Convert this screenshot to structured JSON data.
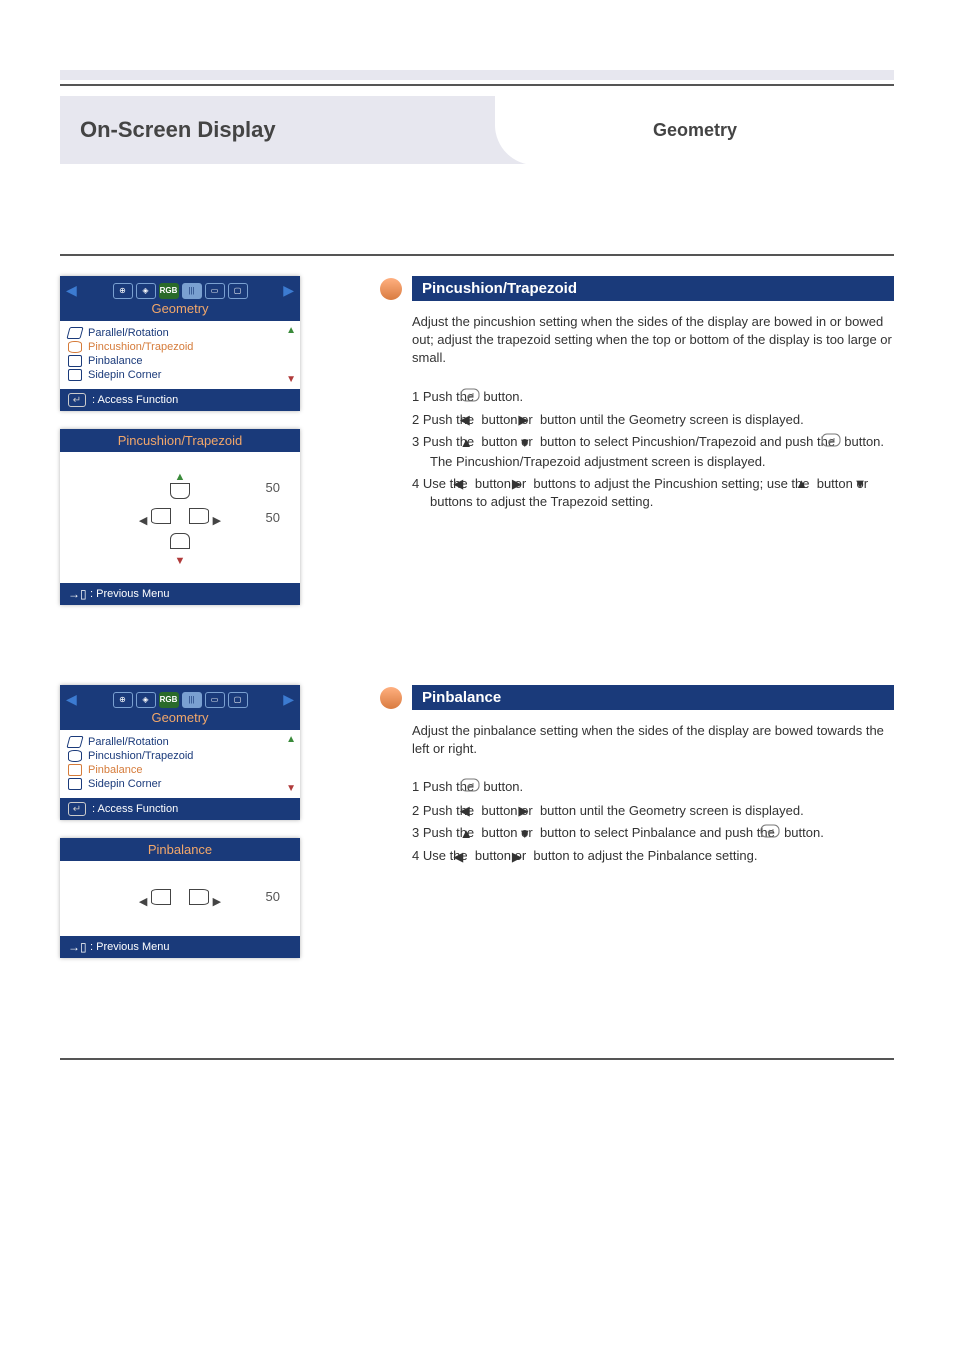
{
  "page_title": "On-Screen Display",
  "page_subtitle": "Geometry",
  "osd_common": {
    "menu_title": "Geometry",
    "items": [
      {
        "label": "Parallel/Rotation"
      },
      {
        "label": "Pincushion/Trapezoid"
      },
      {
        "label": "Pinbalance"
      },
      {
        "label": "Sidepin Corner"
      }
    ],
    "access_label": ": Access Function",
    "previous_label": ": Previous Menu",
    "header_icons": [
      "position",
      "focus",
      "RGB",
      "bars",
      "page",
      "screen"
    ]
  },
  "section_pin": {
    "heading": "Pincushion/Trapezoid",
    "description": "Adjust the pincushion setting when the sides of the display are bowed in or bowed out; adjust the trapezoid setting when the top or bottom of the display is too large or small.",
    "steps": {
      "s1": "1   Push the ",
      "s1b": " button.",
      "s2": "2   Push the ",
      "s2mid": " button or ",
      "s2end": " button until the Geometry screen is displayed.",
      "s3": "3   Push the ",
      "s3mid": " button or ",
      "s3end": " button to select Pincushion/Trapezoid and push the ",
      "s3end2": " button. The Pincushion/Trapezoid adjustment screen is displayed.",
      "s4": "4   Use the ",
      "s4mid": " button or ",
      "s4end": " buttons to adjust the Pincushion setting; use the ",
      "s4b": " button or ",
      "s4c": " buttons to adjust the Trapezoid setting."
    },
    "adjust_title": "Pincushion/Trapezoid",
    "value1": "50",
    "value2": "50"
  },
  "section_pinbal": {
    "heading": "Pinbalance",
    "description": "Adjust the pinbalance setting when the sides of the display are bowed towards the left or right.",
    "steps": {
      "s1": "1   Push the ",
      "s1b": " button.",
      "s2": "2   Push the ",
      "s2mid": " button or ",
      "s2end": " button until the Geometry screen is displayed.",
      "s3": "3   Push the ",
      "s3mid": " button or ",
      "s3end": " button to select Pinbalance and push the ",
      "s3end2": " button.",
      "s4": "4   Use the ",
      "s4mid": " button or ",
      "s4end": " button to adjust the Pinbalance setting."
    },
    "adjust_title": "Pinbalance",
    "value1": "50"
  }
}
